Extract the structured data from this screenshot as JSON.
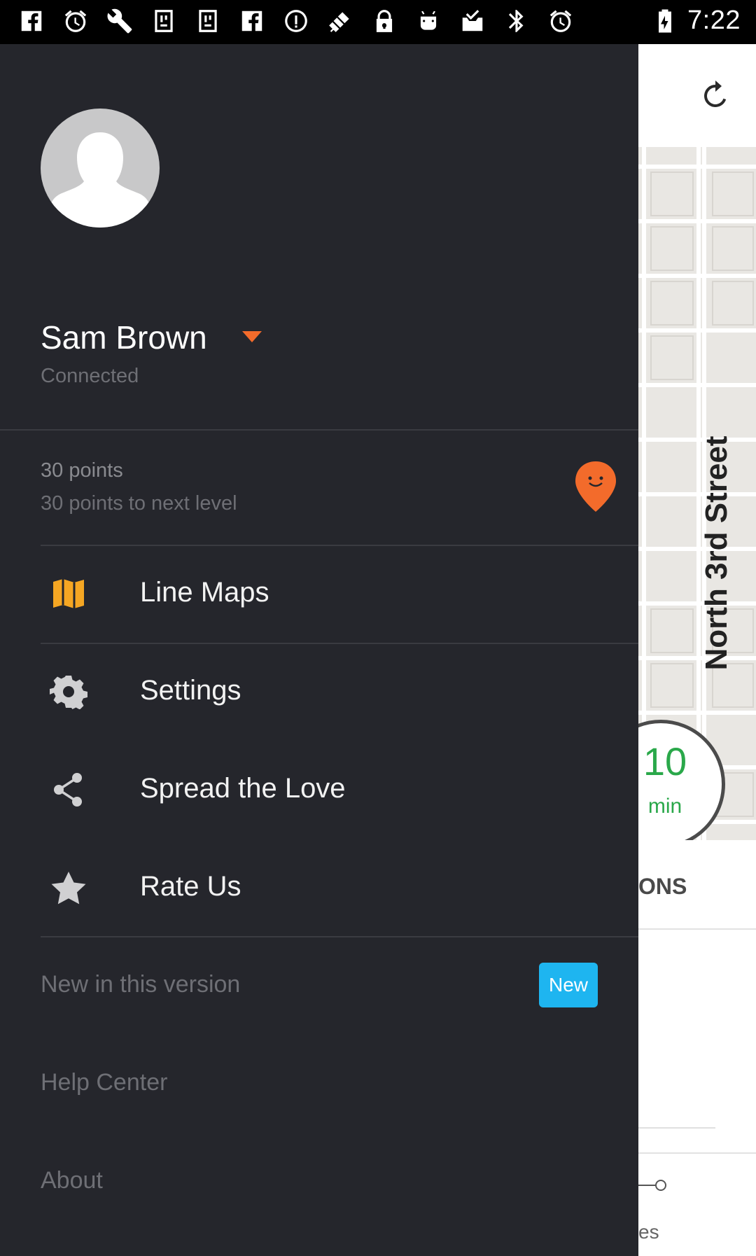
{
  "status_bar": {
    "time": "7:22",
    "icons": [
      "facebook-icon",
      "alarm-icon",
      "wrench-icon",
      "usb-debug-icon",
      "usb-debug-icon",
      "facebook-icon",
      "info-circle-icon",
      "fake-gps-icon",
      "lock-icon",
      "android-icon",
      "tasks-icon",
      "bluetooth-icon",
      "alarm-icon",
      "battery-charging-icon"
    ]
  },
  "drawer": {
    "user": {
      "name": "Sam Brown",
      "status": "Connected"
    },
    "points": {
      "total": "30 points",
      "next_level": "30 points to next level"
    },
    "menu": [
      {
        "label": "Line Maps",
        "icon": "map-icon"
      },
      {
        "label": "Settings",
        "icon": "gear-icon"
      },
      {
        "label": "Spread the Love",
        "icon": "share-icon"
      },
      {
        "label": "Rate Us",
        "icon": "star-icon"
      }
    ],
    "secondary": [
      {
        "label": "New in this version",
        "badge": "New"
      },
      {
        "label": "Help Center"
      },
      {
        "label": "About"
      }
    ],
    "colors": {
      "background": "#25262c",
      "accent": "#f36b2b",
      "badge": "#1eb5f0"
    }
  },
  "background_app": {
    "street": "North 3rd Street",
    "eta": {
      "value": "10",
      "unit": "min"
    },
    "tab_partial": "ONS",
    "footer_partial": "es"
  }
}
